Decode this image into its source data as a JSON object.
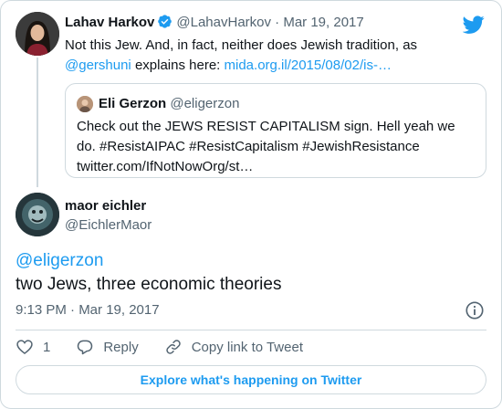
{
  "colors": {
    "link": "#1d9bf0",
    "muted": "#536471",
    "border": "#cfd9de",
    "text": "#0f1419"
  },
  "parent_tweet": {
    "name": "Lahav Harkov",
    "handle": "@LahavHarkov",
    "separator": "·",
    "date": "Mar 19, 2017",
    "text_before": "Not this Jew. And, in fact, neither does Jewish tradition, as ",
    "mention": "@gershuni",
    "text_middle": " explains here: ",
    "url": "mida.org.il/2015/08/02/is-…",
    "avatar_icon": "user-avatar",
    "verified_icon": "verified-badge-icon"
  },
  "quoted_tweet": {
    "name": "Eli Gerzon",
    "handle": "@eligerzon",
    "text": "Check out the JEWS RESIST CAPITALISM sign. Hell yeah we do. #ResistAIPAC #ResistCapitalism #JewishResistance twitter.com/IfNotNowOrg/st…"
  },
  "main_tweet": {
    "name": "maor eichler",
    "handle": "@EichlerMaor",
    "mention": "@eligerzon",
    "text": "two Jews, three economic theories",
    "time": "9:13 PM · Mar 19, 2017"
  },
  "actions": {
    "like_count": "1",
    "reply_label": "Reply",
    "copy_label": "Copy link to Tweet"
  },
  "explore_label": "Explore what's happening on Twitter"
}
